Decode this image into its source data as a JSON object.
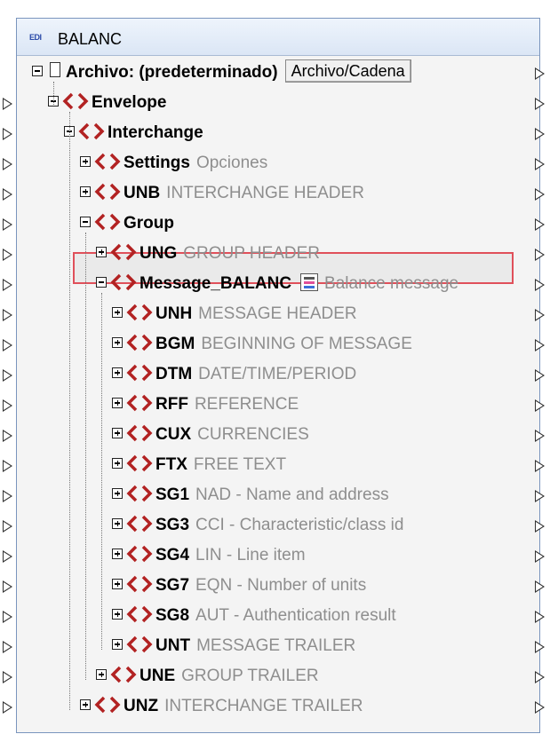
{
  "component": {
    "icon": "edi-icon",
    "icon_text": "EDI",
    "title": "BALANC"
  },
  "root": {
    "label": "Archivo: (predeterminado)",
    "button": "Archivo/Cadena"
  },
  "tree": [
    {
      "name": "Envelope",
      "desc": "",
      "expanded": true
    },
    {
      "name": "Interchange",
      "desc": "",
      "expanded": true
    },
    {
      "name": "Settings",
      "desc": "Opciones",
      "expanded": false
    },
    {
      "name": "UNB",
      "desc": "INTERCHANGE HEADER",
      "expanded": false
    },
    {
      "name": "Group",
      "desc": "",
      "expanded": true
    },
    {
      "name": "UNG",
      "desc": "GROUP HEADER",
      "expanded": false
    },
    {
      "name": "Message_BALANC",
      "desc": "Balance message",
      "expanded": true,
      "selected": true
    },
    {
      "name": "UNH",
      "desc": "MESSAGE HEADER",
      "expanded": false
    },
    {
      "name": "BGM",
      "desc": "BEGINNING OF MESSAGE",
      "expanded": false
    },
    {
      "name": "DTM",
      "desc": "DATE/TIME/PERIOD",
      "expanded": false
    },
    {
      "name": "RFF",
      "desc": "REFERENCE",
      "expanded": false
    },
    {
      "name": "CUX",
      "desc": "CURRENCIES",
      "expanded": false
    },
    {
      "name": "FTX",
      "desc": "FREE TEXT",
      "expanded": false
    },
    {
      "name": "SG1",
      "desc": "NAD - Name and address",
      "expanded": false
    },
    {
      "name": "SG3",
      "desc": "CCI - Characteristic/class id",
      "expanded": false
    },
    {
      "name": "SG4",
      "desc": "LIN - Line item",
      "expanded": false
    },
    {
      "name": "SG7",
      "desc": "EQN - Number of units",
      "expanded": false
    },
    {
      "name": "SG8",
      "desc": "AUT - Authentication result",
      "expanded": false
    },
    {
      "name": "UNT",
      "desc": "MESSAGE TRAILER",
      "expanded": false
    },
    {
      "name": "UNE",
      "desc": "GROUP TRAILER",
      "expanded": false
    },
    {
      "name": "UNZ",
      "desc": "INTERCHANGE TRAILER",
      "expanded": false
    }
  ],
  "colors": {
    "tag_icon": "#b22222",
    "selection_border": "#e0505a",
    "description_text": "#8e8e8e"
  }
}
